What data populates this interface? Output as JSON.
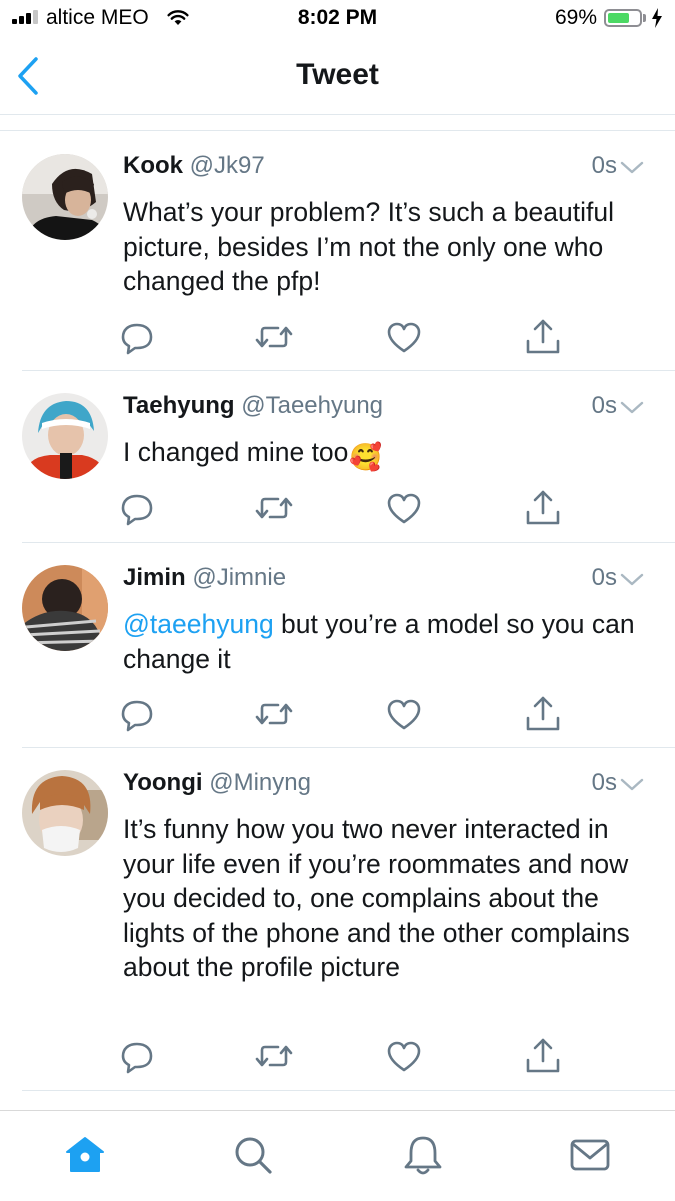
{
  "status_bar": {
    "carrier": "altice MEO",
    "time": "8:02 PM",
    "battery": "69%",
    "battery_level": 0.69,
    "signal_bars_filled": 3,
    "signal_bars_total": 4
  },
  "nav": {
    "title": "Tweet",
    "back_icon": "chevron-left-icon"
  },
  "colors": {
    "accent": "#1da1f2",
    "text": "#14171a",
    "secondary": "#657786",
    "divider": "#e1e8ed",
    "battery": "#4cd964"
  },
  "tweets": [
    {
      "name": "Kook",
      "handle": "@Jk97",
      "time": "0s",
      "text": "What’s your problem? It’s such a beautiful picture, besides I’m not the only one who changed the pfp!"
    },
    {
      "name": "Taehyung",
      "handle": "@Taeehyung",
      "time": "0s",
      "text": "I changed mine too",
      "emoji": "🥰"
    },
    {
      "name": "Jimin",
      "handle": "@Jimnie",
      "time": "0s",
      "mention": "@taeehyung",
      "text": " but you’re a model so you can change it"
    },
    {
      "name": "Yoongi",
      "handle": "@Minyng",
      "time": "0s",
      "text": "It’s funny how you two never interacted in your life even if you’re roommates and now you decided to, one complains about the lights of the phone and the other complains about the profile picture"
    }
  ],
  "action_icons": [
    "reply-icon",
    "retweet-icon",
    "like-icon",
    "share-icon"
  ],
  "tab_bar": {
    "tabs": [
      "home-icon",
      "search-icon",
      "notifications-icon",
      "messages-icon"
    ],
    "active": "home-icon"
  }
}
